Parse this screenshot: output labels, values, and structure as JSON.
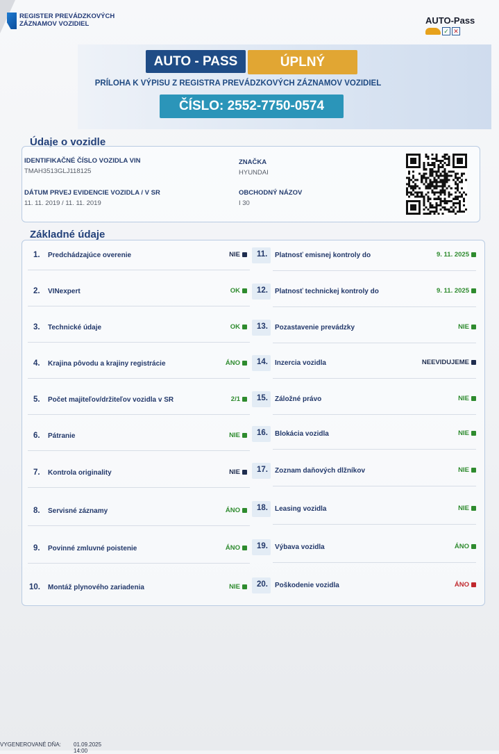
{
  "header": {
    "registry_logo": "REGISTER PREVÁDZKOVÝCH ZÁZNAMOV VOZIDIEL",
    "registry_line1": "REGISTER PREVÁDZKOVÝCH",
    "registry_line2": "ZÁZNAMOV VOZIDIEL",
    "brand": "AUTO-Pass"
  },
  "banner": {
    "product": "AUTO - PASS",
    "variant": "ÚPLNÝ",
    "annex": "PRÍLOHA K VÝPISU Z REGISTRA PREVÁDZKOVÝCH ZÁZNAMOV VOZIDIEL",
    "number": "ČÍSLO: 2552-7750-0574"
  },
  "vehicle": {
    "title": "Údaje o vozidle",
    "vin_label": "IDENTIFIKAČNÉ ČÍSLO VOZIDLA VIN",
    "vin": "TMAH3513GLJ118125",
    "first_reg_label": "DÁTUM PRVEJ EVIDENCIE VOZIDLA / V SR",
    "first_reg": "11. 11. 2019 / 11. 11. 2019",
    "make_label": "ZNAČKA",
    "make": "HYUNDAI",
    "model_label": "OBCHODNÝ NÁZOV",
    "model": "I 30"
  },
  "basic": {
    "title": "Základné údaje",
    "left": [
      {
        "num": "1.",
        "label": "Predchádzajúce overenie",
        "status": "NIE",
        "color": "#1f2d4f"
      },
      {
        "num": "2.",
        "label": "VINexpert",
        "status": "OK",
        "color": "#2e8b2e"
      },
      {
        "num": "3.",
        "label": "Technické údaje",
        "status": "OK",
        "color": "#2e8b2e"
      },
      {
        "num": "4.",
        "label": "Krajina pôvodu a krajiny registrácie",
        "status": "ÁNO",
        "color": "#2e8b2e"
      },
      {
        "num": "5.",
        "label": "Počet majiteľov/držiteľov vozidla v SR",
        "status": "2/1",
        "color": "#2e8b2e"
      },
      {
        "num": "6.",
        "label": "Pátranie",
        "status": "NIE",
        "color": "#2e8b2e"
      },
      {
        "num": "7.",
        "label": "Kontrola originality",
        "status": "NIE",
        "color": "#1f2d4f"
      },
      {
        "num": "8.",
        "label": "Servisné záznamy",
        "status": "ÁNO",
        "color": "#2e8b2e"
      },
      {
        "num": "9.",
        "label": "Povinné zmluvné poistenie",
        "status": "ÁNO",
        "color": "#2e8b2e"
      },
      {
        "num": "10.",
        "label": "Montáž plynového zariadenia",
        "status": "NIE",
        "color": "#2e8b2e"
      }
    ],
    "right": [
      {
        "num": "11.",
        "label": "Platnosť emisnej kontroly do",
        "status": "9. 11. 2025",
        "color": "#2e8b2e"
      },
      {
        "num": "12.",
        "label": "Platnosť technickej kontroly do",
        "status": "9. 11. 2025",
        "color": "#2e8b2e"
      },
      {
        "num": "13.",
        "label": "Pozastavenie prevádzky",
        "status": "NIE",
        "color": "#2e8b2e"
      },
      {
        "num": "14.",
        "label": "Inzercia vozidla",
        "status": "NEEVIDUJEME",
        "color": "#1f2d4f"
      },
      {
        "num": "15.",
        "label": "Záložné právo",
        "status": "NIE",
        "color": "#2e8b2e"
      },
      {
        "num": "16.",
        "label": "Blokácia vozidla",
        "status": "NIE",
        "color": "#2e8b2e"
      },
      {
        "num": "17.",
        "label": "Zoznam daňových dlžníkov",
        "status": "NIE",
        "color": "#2e8b2e"
      },
      {
        "num": "18.",
        "label": "Leasing vozidla",
        "status": "NIE",
        "color": "#2e8b2e"
      },
      {
        "num": "19.",
        "label": "Výbava vozidla",
        "status": "ÁNO",
        "color": "#2e8b2e"
      },
      {
        "num": "20.",
        "label": "Poškodenie vozidla",
        "status": "ÁNO",
        "color": "#c0282d"
      }
    ]
  },
  "footer": {
    "label": "VYGENEROVANÉ DŇA:",
    "value": "01.09.2025 14:00"
  }
}
